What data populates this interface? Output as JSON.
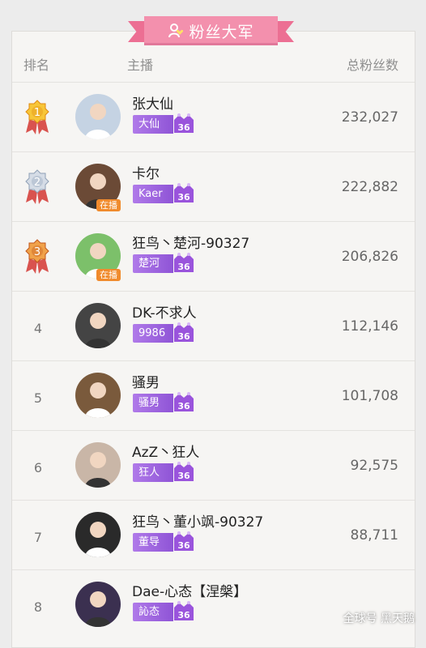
{
  "banner": {
    "title": "粉丝大军",
    "icon": "fan-user-icon",
    "color": "#f390ad"
  },
  "header": {
    "rank": "排名",
    "anchor": "主播",
    "fans": "总粉丝数"
  },
  "rows": [
    {
      "rank": "1",
      "medal": "gold",
      "name": "张大仙",
      "badge": "大仙",
      "level": "36",
      "fans": "232,027",
      "live": ""
    },
    {
      "rank": "2",
      "medal": "silver",
      "name": "卡尔",
      "badge": "Kaer",
      "level": "36",
      "fans": "222,882",
      "live": "在播"
    },
    {
      "rank": "3",
      "medal": "bronze",
      "name": "狂鸟丶楚河-90327",
      "badge": "楚河",
      "level": "36",
      "fans": "206,826",
      "live": "在播"
    },
    {
      "rank": "4",
      "medal": "",
      "name": "DK-不求人",
      "badge": "9986",
      "level": "36",
      "fans": "112,146",
      "live": ""
    },
    {
      "rank": "5",
      "medal": "",
      "name": "骚男",
      "badge": "骚男",
      "level": "36",
      "fans": "101,708",
      "live": ""
    },
    {
      "rank": "6",
      "medal": "",
      "name": "AzZ丶狂人",
      "badge": "狂人",
      "level": "36",
      "fans": "92,575",
      "live": ""
    },
    {
      "rank": "7",
      "medal": "",
      "name": "狂鸟丶董小飒-90327",
      "badge": "董导",
      "level": "36",
      "fans": "88,711",
      "live": ""
    },
    {
      "rank": "8",
      "medal": "",
      "name": "Dae-心态【涅槃】",
      "badge": "訫态",
      "level": "36",
      "fans": "",
      "live": ""
    }
  ],
  "watermark": "全球号 黑天鹅"
}
